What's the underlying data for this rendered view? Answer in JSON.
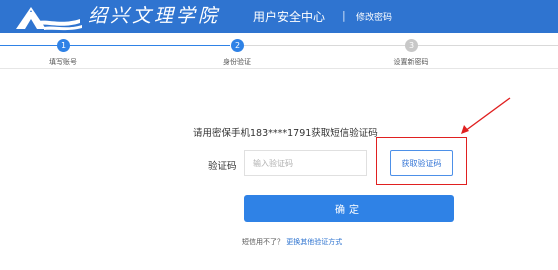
{
  "header": {
    "college_name": "绍兴文理学院",
    "center_title": "用户安全中心",
    "separator": "|",
    "subtitle": "修改密码",
    "logo_icon": "mountain-logo-icon",
    "background_color": "#2f74d0"
  },
  "steps": {
    "items": [
      {
        "number": "1",
        "label": "填写账号",
        "status": "done"
      },
      {
        "number": "2",
        "label": "身份验证",
        "status": "active"
      },
      {
        "number": "3",
        "label": "设置新密码",
        "status": "pending"
      }
    ],
    "active_color": "#2f82e6",
    "pending_color": "#c8c8c8"
  },
  "form": {
    "prompt": "请用密保手机183****1791获取短信验证码",
    "code_label": "验证码",
    "code_placeholder": "输入验证码",
    "code_value": "",
    "get_code_button": "获取验证码",
    "confirm_button": "确定",
    "alt_prompt": "短信用不了？",
    "alt_link": "更换其他验证方式"
  },
  "annotation": {
    "highlight_color": "#e02020"
  }
}
